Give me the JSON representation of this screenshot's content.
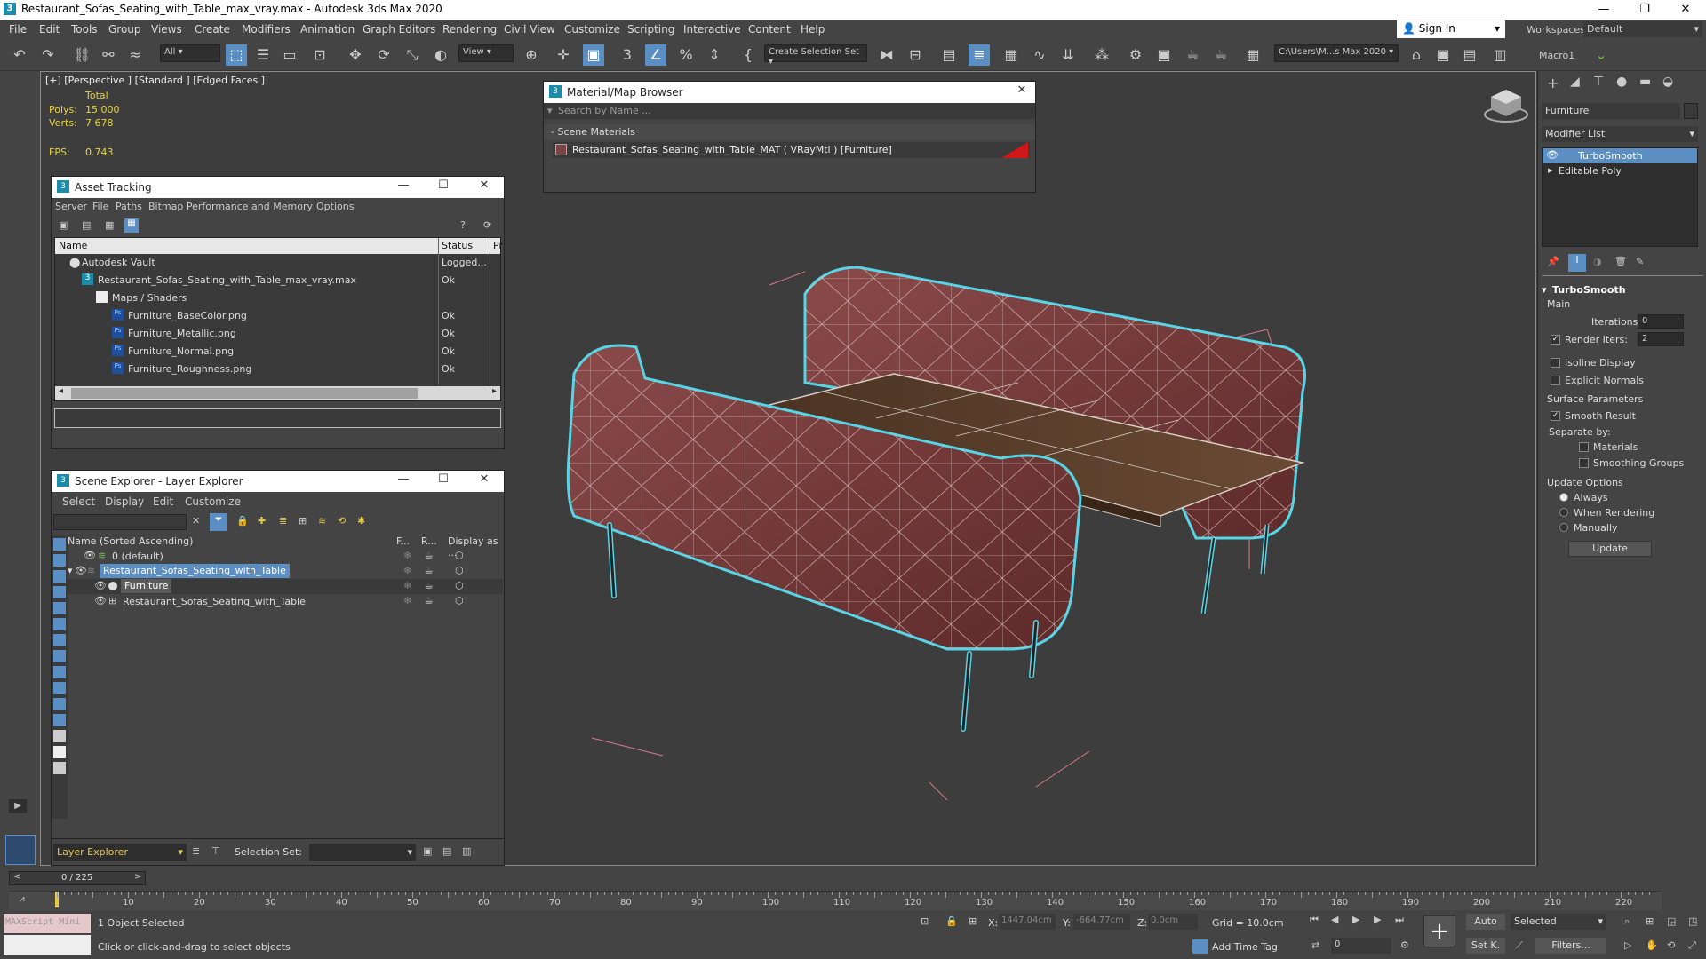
{
  "window": {
    "title": "Restaurant_Sofas_Seating_with_Table_max_vray.max - Autodesk 3ds Max 2020",
    "min": "—",
    "max": "❐",
    "close": "✕"
  },
  "menu": [
    "File",
    "Edit",
    "Tools",
    "Group",
    "Views",
    "Create",
    "Modifiers",
    "Animation",
    "Graph Editors",
    "Rendering",
    "Civil View",
    "Customize",
    "Scripting",
    "Interactive",
    "Content",
    "Help"
  ],
  "signin": "Sign In",
  "workspaces_label": "Workspaces:",
  "workspaces_value": "Default",
  "toolbar": {
    "filter_all": "All",
    "view": "View",
    "selection_set": "Create Selection Set",
    "path": "C:\\Users\\M...s Max 2020",
    "macro": "Macro1"
  },
  "viewport": {
    "label": "[+] [Perspective ] [Standard ] [Edged Faces ]",
    "total": "Total",
    "polys_label": "Polys:",
    "polys": "15 000",
    "verts_label": "Verts:",
    "verts": "7 678",
    "fps_label": "FPS:",
    "fps": "0.743"
  },
  "material_browser": {
    "title": "Material/Map Browser",
    "search_placeholder": "Search by Name ...",
    "section": "- Scene Materials",
    "item": "Restaurant_Sofas_Seating_with_Table_MAT  ( VRayMtl )  [Furniture]"
  },
  "asset_tracking": {
    "title": "Asset Tracking",
    "menu": [
      "Server",
      "File",
      "Paths",
      "Bitmap Performance and Memory",
      "Options"
    ],
    "col_name": "Name",
    "col_status": "Status",
    "col_pr": "Pr",
    "rows": [
      {
        "name": "Autodesk Vault",
        "status": "Logged..."
      },
      {
        "name": "Restaurant_Sofas_Seating_with_Table_max_vray.max",
        "status": "Ok"
      },
      {
        "name": "Maps / Shaders",
        "status": ""
      },
      {
        "name": "Furniture_BaseColor.png",
        "status": "Ok"
      },
      {
        "name": "Furniture_Metallic.png",
        "status": "Ok"
      },
      {
        "name": "Furniture_Normal.png",
        "status": "Ok"
      },
      {
        "name": "Furniture_Roughness.png",
        "status": "Ok"
      }
    ]
  },
  "scene_explorer": {
    "title": "Scene Explorer - Layer Explorer",
    "menu": [
      "Select",
      "Display",
      "Edit",
      "Customize"
    ],
    "col_name": "Name (Sorted Ascending)",
    "col_f": "F...",
    "col_r": "R...",
    "col_display": "Display as ...",
    "rows": [
      {
        "name": "0 (default)"
      },
      {
        "name": "Restaurant_Sofas_Seating_with_Table"
      },
      {
        "name": "Furniture"
      },
      {
        "name": "Restaurant_Sofas_Seating_with_Table"
      }
    ],
    "footer_layer": "Layer Explorer",
    "selection_set_label": "Selection Set:"
  },
  "command_panel": {
    "object_name": "Furniture",
    "modifier_list": "Modifier List",
    "stack": [
      "TurboSmooth",
      "Editable Poly"
    ],
    "rollout": "TurboSmooth",
    "main": "Main",
    "iterations_label": "Iterations:",
    "iterations": "0",
    "render_iters_label": "Render Iters:",
    "render_iters": "2",
    "isoline": "Isoline Display",
    "explicit_normals": "Explicit Normals",
    "surface_params": "Surface Parameters",
    "smooth_result": "Smooth Result",
    "separate_by": "Separate by:",
    "materials": "Materials",
    "smoothing_groups": "Smoothing Groups",
    "update_options": "Update Options",
    "always": "Always",
    "when_rendering": "When Rendering",
    "manually": "Manually",
    "update_btn": "Update"
  },
  "timeline": {
    "frame": "0 / 225",
    "ticks": [
      "10",
      "20",
      "30",
      "40",
      "50",
      "60",
      "70",
      "80",
      "90",
      "100",
      "110",
      "120",
      "130",
      "140",
      "150",
      "160",
      "170",
      "180",
      "190",
      "200",
      "210",
      "220"
    ]
  },
  "status": {
    "maxscript": "MAXScript Mini",
    "selected": "1 Object Selected",
    "hint": "Click or click-and-drag to select objects",
    "x_label": "X:",
    "x": "1447.04cm",
    "y_label": "Y:",
    "y": "-664.77cm",
    "z_label": "Z:",
    "z": "0.0cm",
    "grid": "Grid = 10.0cm",
    "add_time_tag": "Add Time Tag",
    "auto": "Auto",
    "set_k": "Set K.",
    "selected_dd": "Selected",
    "filters": "Filters...",
    "frame_field": "0"
  }
}
